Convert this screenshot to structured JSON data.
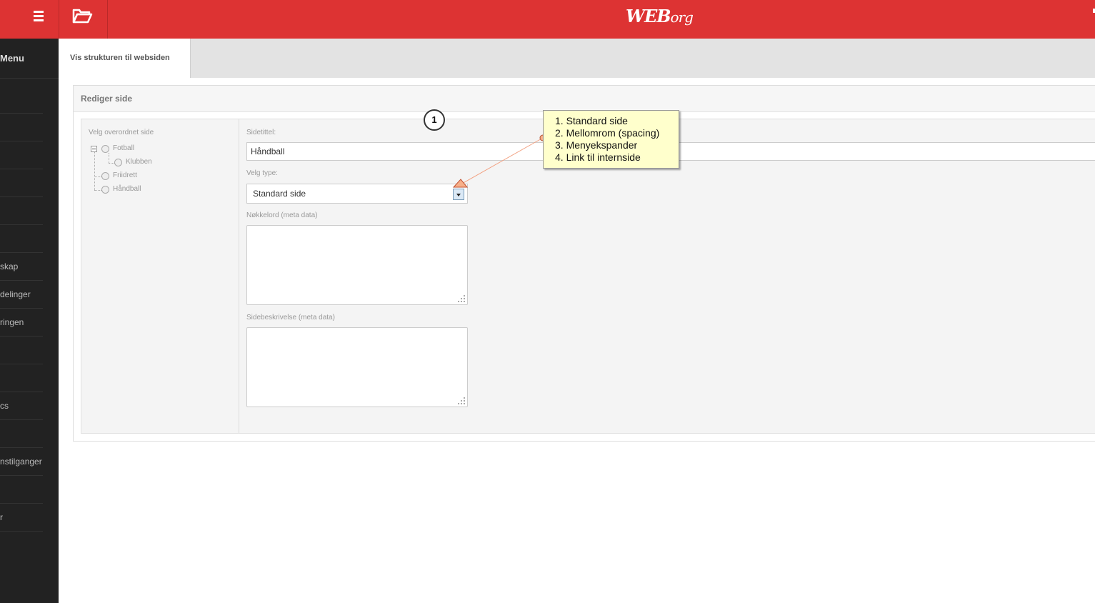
{
  "header": {
    "logo_text": "WEB",
    "logo_suffix": "org",
    "brand_color": "#dd3333",
    "menu_icon": "hamburger-icon",
    "folder_icon": "folder-icon"
  },
  "sidebar": {
    "title": "Menu",
    "items": [
      {
        "label": ""
      },
      {
        "label": ""
      },
      {
        "label": ""
      },
      {
        "label": ""
      },
      {
        "label": ""
      },
      {
        "label": ""
      },
      {
        "label": "skap"
      },
      {
        "label": "delinger"
      },
      {
        "label": "ringen"
      },
      {
        "label": ""
      },
      {
        "label": ""
      },
      {
        "label": "cs"
      },
      {
        "label": ""
      },
      {
        "label": "nstilganger"
      },
      {
        "label": ""
      },
      {
        "label": "r"
      }
    ]
  },
  "tabs": {
    "active": "Vis strukturen til websiden"
  },
  "panel": {
    "title": "Rediger side",
    "tree": {
      "label": "Velg overordnet side",
      "nodes": [
        {
          "label": "Fotball"
        },
        {
          "label": "Klubben"
        },
        {
          "label": "Friidrett"
        },
        {
          "label": "Håndball"
        }
      ]
    },
    "form": {
      "title_label": "Sidetittel:",
      "title_value": "Håndball",
      "type_label": "Velg type:",
      "type_value": "Standard side",
      "keywords_label": "Nøkkelord (meta data)",
      "keywords_value": "",
      "description_label": "Sidebeskrivelse (meta data)",
      "description_value": ""
    }
  },
  "annotation": {
    "step_number": "1",
    "items": [
      "1. Standard side",
      "2. Mellomrom (spacing)",
      "3. Menyekspander",
      "4. Link til internside"
    ]
  }
}
